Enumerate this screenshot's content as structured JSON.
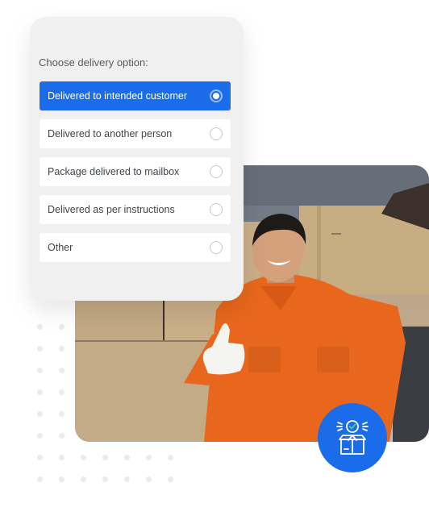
{
  "card": {
    "title": "Choose delivery option:",
    "options": [
      {
        "label": "Delivered to intended customer",
        "selected": true
      },
      {
        "label": "Delivered to another person",
        "selected": false
      },
      {
        "label": "Package delivered to mailbox",
        "selected": false
      },
      {
        "label": "Delivered as per instructions",
        "selected": false
      },
      {
        "label": "Other",
        "selected": false
      }
    ]
  },
  "photo": {
    "description": "Smiling delivery worker in orange uniform carrying a cardboard box and giving a thumbs up"
  },
  "badge": {
    "icon": "package-delivered-check-icon"
  },
  "colors": {
    "accent": "#1a6cea",
    "card_background": "#f0f0f0",
    "dot": "#ebebeb"
  }
}
